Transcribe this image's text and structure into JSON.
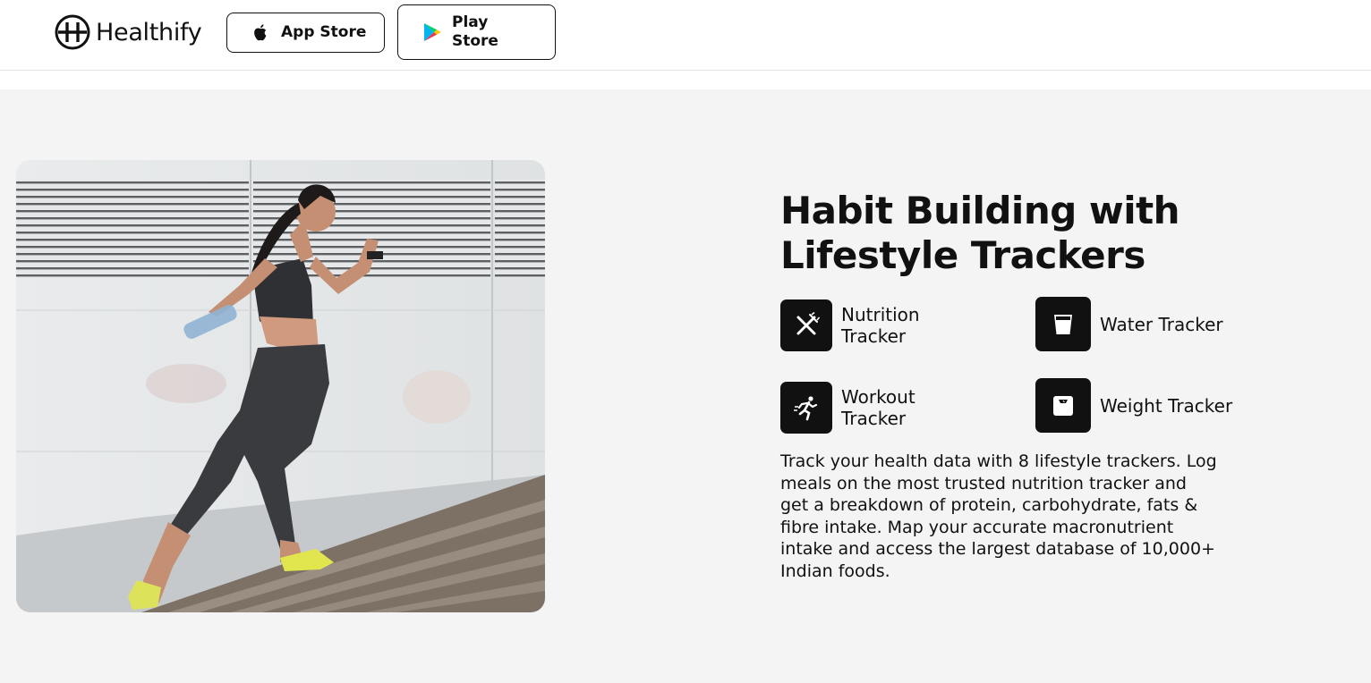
{
  "header": {
    "brand": "Healthify",
    "app_store_label": "App Store",
    "play_store_label": "Play Store"
  },
  "hero": {
    "title": "Habit Building with Lifestyle Trackers",
    "trackers": [
      {
        "label": "Nutrition Tracker",
        "icon": "fork-knife-icon"
      },
      {
        "label": "Water Tracker",
        "icon": "water-glass-icon"
      },
      {
        "label": "Workout Tracker",
        "icon": "running-person-icon"
      },
      {
        "label": "Weight Tracker",
        "icon": "weighing-scale-icon"
      }
    ],
    "description": "Track your health data with 8 lifestyle trackers. Log meals on the most trusted nutrition tracker and get a breakdown of protein, carbohydrate, fats & fibre intake. Map your accurate macronutrient intake and access the largest database of 10,000+ Indian foods."
  },
  "colors": {
    "background": "#f4f4f4",
    "header_bg": "#ffffff",
    "text": "#111111",
    "icon_tile": "#111111"
  }
}
